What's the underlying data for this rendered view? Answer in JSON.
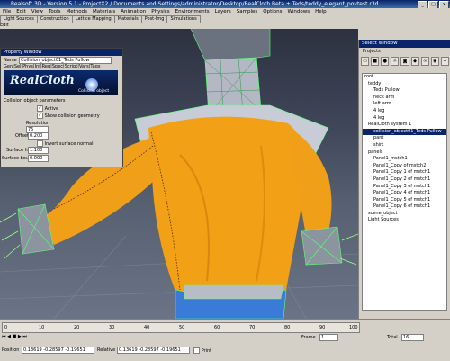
{
  "window": {
    "title": "Realsoft 3D - Version 5.1 - ProjectX2 / Documents and Settings/administrator/Desktop/RealCloth Beta + Teds/teddy_elegant_povtest.r3d",
    "buttons": [
      "_",
      "□",
      "x"
    ]
  },
  "menu": [
    "File",
    "Edit",
    "View",
    "Tools",
    "Methods",
    "Materials",
    "Animation",
    "Physics",
    "Environments",
    "Layers",
    "Samples",
    "Options",
    "Windows",
    "Help"
  ],
  "tabs": [
    "Light Sources",
    "Construction",
    "Lattice Mapping",
    "Materials",
    "Post-Img",
    "Simulations"
  ],
  "edit_label": "Edit",
  "property_window": {
    "title": "Property Window",
    "name_label": "Name",
    "name_value": "Collision_object01_Teds Pullow",
    "tabs": [
      "Gen",
      "Sel",
      "Phys",
      "Inf",
      "Reg",
      "Spec",
      "Script",
      "Vars",
      "Tags"
    ],
    "logo_text": "RealCloth",
    "logo_sub": "Collision object",
    "section": "Collision object parameters",
    "active_label": "Active",
    "show_geometry_label": "Show collision geometry",
    "resolution_label": "Resolution",
    "resolution_value": "75",
    "offset_label": "Offset",
    "offset_value": "0.200",
    "invert_label": "Invert surface normal",
    "friction_label": "Surface friction",
    "friction_value": "1.100",
    "bounciness_label": "Surface bounciness",
    "bounciness_value": "0.000"
  },
  "select_window": {
    "title": "Select window",
    "subtitle": "Projects",
    "icons": [
      "folder-icon",
      "cube-icon",
      "sphere-icon",
      "light-icon",
      "camera-icon",
      "material-icon",
      "link-icon",
      "eye-icon",
      "plus-icon"
    ],
    "tree": [
      "root",
      "teddy",
      "Teds Pullow",
      "neck arm",
      "left arm",
      "4 leg",
      "4 leg",
      "RealCloth system 1",
      "collision_object01_Teds Pullow",
      "pant",
      "shirt",
      "panels",
      "Panel1_mstch1",
      "Panel1_Copy of mstch2",
      "Panel1_Copy 1 of mstch1",
      "Panel1_Copy 2 of mstch1",
      "Panel1_Copy 3 of mstch1",
      "Panel1_Copy 4 of mstch1",
      "Panel1_Copy 5 of mstch1",
      "Panel1_Copy 6 of mstch1",
      "scene_object",
      "Light Sources"
    ]
  },
  "bottom": {
    "frame_label": "Frame",
    "frame_value": "1",
    "total_label": "Total",
    "total_value": "16",
    "position_label": "Position",
    "position_value": "0.13619 -0.28597 -0.19651",
    "relative_label": "Relative",
    "relative_value": "0.13619 -0.28597 -0.19651",
    "print_label": "Print",
    "timeline_ticks": [
      "0",
      "10",
      "20",
      "30",
      "40",
      "50",
      "60",
      "70",
      "80",
      "90",
      "100"
    ]
  },
  "colors": {
    "title_blue": "#0a246a",
    "sweater": "#f2a015",
    "mesh": "#5cff7a",
    "jeans": "#3a7bd8"
  }
}
